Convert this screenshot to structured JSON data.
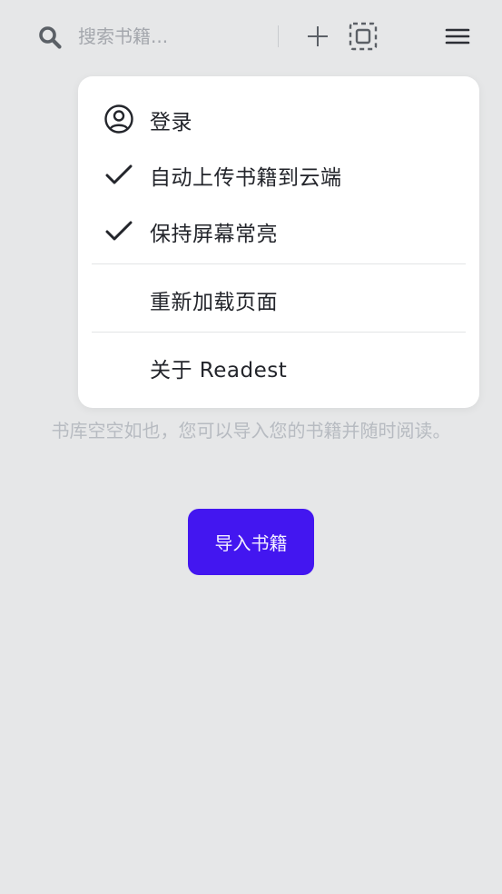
{
  "search": {
    "placeholder": "搜索书籍..."
  },
  "toolbar": {
    "add_icon": "plus-icon",
    "select_icon": "select-dashed-icon",
    "menu_icon": "hamburger-icon"
  },
  "library": {
    "empty_message": "书库空空如也，您可以导入您的书籍并随时阅读。",
    "import_button": "导入书籍"
  },
  "menu": {
    "items": [
      {
        "label": "登录",
        "icon": "user-circle-icon"
      },
      {
        "label": "自动上传书籍到云端",
        "icon": "check-icon",
        "checked": true
      },
      {
        "label": "保持屏幕常亮",
        "icon": "check-icon",
        "checked": true
      },
      {
        "label": "重新加载页面"
      },
      {
        "label": "关于 Readest"
      }
    ]
  },
  "colors": {
    "accent": "#4316f0",
    "background": "#e6e7e8",
    "menu_bg": "#ffffff"
  }
}
